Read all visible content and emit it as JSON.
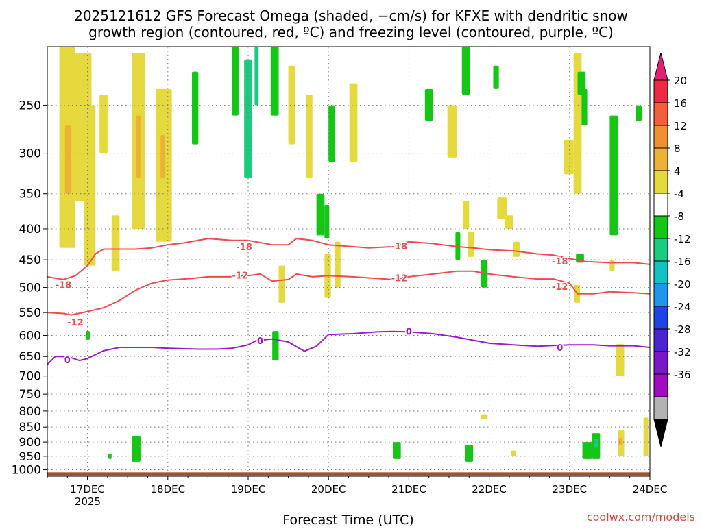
{
  "title_line1": "2025121612 GFS Forecast Omega (shaded, −cm/s) for KFXE with dendritic snow",
  "title_line2": "growth region (contoured, red, ºC) and freezing level (contoured, purple, ºC)",
  "xlabel": "Forecast Time (UTC)",
  "credit": "coolwx.com/models",
  "chart_data": {
    "type": "heatmap",
    "title": "2025121612 GFS Forecast Omega (shaded, −cm/s) for KFXE with dendritic snow growth region (contoured, red, ºC) and freezing level (contoured, purple, ºC)",
    "xlabel": "Forecast Time (UTC)",
    "ylabel": "",
    "x_tick_labels": [
      "17DEC",
      "18DEC",
      "19DEC",
      "20DEC",
      "21DEC",
      "22DEC",
      "23DEC",
      "24DEC"
    ],
    "x_tick_values": [
      17,
      18,
      19,
      20,
      21,
      22,
      23,
      24
    ],
    "x_year_label": "2025",
    "xlim": [
      16.5,
      24.0
    ],
    "y_tick_labels": [
      "250",
      "300",
      "350",
      "400",
      "450",
      "500",
      "550",
      "600",
      "650",
      "700",
      "750",
      "800",
      "850",
      "900",
      "950",
      "1000"
    ],
    "y_tick_values": [
      250,
      300,
      350,
      400,
      450,
      500,
      550,
      600,
      650,
      700,
      750,
      800,
      850,
      900,
      950,
      1000
    ],
    "ylim": [
      200,
      1025
    ],
    "y_scale": "log",
    "grid": true,
    "colorbar": {
      "labels": [
        "20",
        "16",
        "12",
        "8",
        "4",
        "-4",
        "-8",
        "-12",
        "-16",
        "-20",
        "-24",
        "-28",
        "-32",
        "-36"
      ],
      "colors": [
        "#ee2a43",
        "#f0603a",
        "#f09030",
        "#ecb238",
        "#e6d93d",
        "#ffffff",
        "#15c715",
        "#1acc80",
        "#12c2c2",
        "#1e96ea",
        "#1f44e6",
        "#4a23d2",
        "#7a18c8",
        "#a00cc0",
        "#b3b3b3"
      ],
      "top_arrow_color": "#e61e78",
      "bottom_arrow_color": "#000000"
    },
    "series": [
      {
        "name": "-18",
        "color": "#f24a4a",
        "x": [
          16.5,
          16.7,
          16.85,
          17.0,
          17.1,
          17.2,
          17.4,
          17.6,
          17.8,
          18.0,
          18.2,
          18.5,
          18.8,
          19.0,
          19.3,
          19.5,
          19.6,
          19.8,
          20.0,
          20.3,
          20.5,
          20.8,
          21.0,
          21.3,
          21.6,
          21.8,
          22.0,
          22.3,
          22.6,
          22.8,
          23.0,
          23.2,
          23.5,
          23.8,
          24.0
        ],
        "y": [
          480,
          485,
          478,
          460,
          440,
          432,
          432,
          432,
          430,
          425,
          422,
          415,
          418,
          418,
          425,
          425,
          415,
          418,
          425,
          428,
          430,
          428,
          420,
          423,
          428,
          430,
          433,
          435,
          440,
          442,
          448,
          453,
          455,
          455,
          458
        ]
      },
      {
        "name": "-12",
        "color": "#f24a4a",
        "x": [
          16.5,
          16.7,
          16.8,
          17.0,
          17.2,
          17.4,
          17.6,
          17.8,
          18.0,
          18.3,
          18.5,
          18.8,
          19.0,
          19.15,
          19.3,
          19.5,
          19.6,
          19.8,
          20.0,
          20.3,
          20.5,
          20.8,
          21.0,
          21.3,
          21.6,
          21.8,
          22.0,
          22.3,
          22.6,
          22.8,
          23.0,
          23.1,
          23.3,
          23.5,
          23.8,
          24.0
        ],
        "y": [
          550,
          552,
          555,
          548,
          540,
          525,
          505,
          492,
          486,
          483,
          480,
          480,
          478,
          475,
          488,
          485,
          475,
          480,
          478,
          480,
          482,
          485,
          480,
          475,
          470,
          470,
          475,
          480,
          484,
          484,
          492,
          512,
          512,
          508,
          510,
          512
        ]
      },
      {
        "name": "0",
        "color": "#9d19cc",
        "x": [
          16.5,
          16.6,
          16.75,
          16.9,
          17.0,
          17.2,
          17.4,
          17.6,
          17.8,
          18.0,
          18.2,
          18.4,
          18.6,
          18.8,
          19.0,
          19.1,
          19.3,
          19.5,
          19.7,
          19.85,
          20.0,
          20.3,
          20.6,
          20.8,
          21.0,
          21.3,
          21.6,
          22.0,
          22.3,
          22.6,
          23.0,
          23.3,
          23.5,
          23.8,
          24.0
        ],
        "y": [
          670,
          650,
          650,
          660,
          655,
          636,
          628,
          628,
          628,
          630,
          631,
          632,
          632,
          630,
          622,
          612,
          608,
          615,
          637,
          625,
          598,
          596,
          592,
          591,
          592,
          596,
          604,
          618,
          622,
          625,
          622,
          622,
          624,
          624,
          628
        ]
      }
    ],
    "contour_labels": [
      {
        "text": "-18",
        "x": 18.95,
        "y": 428,
        "color": "#f24a4a"
      },
      {
        "text": "-18",
        "x": 20.88,
        "y": 427,
        "color": "#f24a4a"
      },
      {
        "text": "-18",
        "x": 22.88,
        "y": 452,
        "color": "#f24a4a"
      },
      {
        "text": "-18",
        "x": 16.7,
        "y": 495,
        "color": "#f24a4a"
      },
      {
        "text": "-12",
        "x": 18.9,
        "y": 477,
        "color": "#f24a4a"
      },
      {
        "text": "-12",
        "x": 20.88,
        "y": 482,
        "color": "#f24a4a"
      },
      {
        "text": "-12",
        "x": 22.88,
        "y": 498,
        "color": "#f24a4a"
      },
      {
        "text": "-12",
        "x": 16.85,
        "y": 570,
        "color": "#f24a4a"
      },
      {
        "text": "0",
        "x": 19.15,
        "y": 612,
        "color": "#9d19cc"
      },
      {
        "text": "0",
        "x": 21.0,
        "y": 591,
        "color": "#9d19cc"
      },
      {
        "text": "0",
        "x": 22.88,
        "y": 628,
        "color": "#9d19cc"
      },
      {
        "text": "0",
        "x": 16.75,
        "y": 658,
        "color": "#9d19cc"
      }
    ],
    "omega_regions": [
      {
        "value": 6,
        "x": [
          16.65,
          16.85
        ],
        "y": [
          200,
          430
        ]
      },
      {
        "value": 10,
        "x": [
          16.72,
          16.8
        ],
        "y": [
          270,
          350
        ]
      },
      {
        "value": 6,
        "x": [
          16.85,
          17.05
        ],
        "y": [
          205,
          360
        ]
      },
      {
        "value": 6,
        "x": [
          16.96,
          17.1
        ],
        "y": [
          250,
          460
        ]
      },
      {
        "value": 6,
        "x": [
          17.15,
          17.25
        ],
        "y": [
          240,
          300
        ]
      },
      {
        "value": 6,
        "x": [
          17.3,
          17.4
        ],
        "y": [
          380,
          470
        ]
      },
      {
        "value": 6,
        "x": [
          17.55,
          17.72
        ],
        "y": [
          205,
          400
        ]
      },
      {
        "value": 10,
        "x": [
          17.6,
          17.66
        ],
        "y": [
          260,
          330
        ]
      },
      {
        "value": 6,
        "x": [
          17.85,
          18.05
        ],
        "y": [
          235,
          420
        ]
      },
      {
        "value": 10,
        "x": [
          17.91,
          17.96
        ],
        "y": [
          280,
          330
        ]
      },
      {
        "value": 6,
        "x": [
          19.38,
          19.46
        ],
        "y": [
          460,
          530
        ]
      },
      {
        "value": 6,
        "x": [
          19.5,
          19.58
        ],
        "y": [
          215,
          290
        ]
      },
      {
        "value": 6,
        "x": [
          19.72,
          19.8
        ],
        "y": [
          240,
          330
        ]
      },
      {
        "value": 6,
        "x": [
          19.95,
          20.03
        ],
        "y": [
          440,
          520
        ]
      },
      {
        "value": 6,
        "x": [
          20.08,
          20.15
        ],
        "y": [
          420,
          500
        ]
      },
      {
        "value": 6,
        "x": [
          20.26,
          20.36
        ],
        "y": [
          230,
          310
        ]
      },
      {
        "value": 6,
        "x": [
          21.48,
          21.6
        ],
        "y": [
          250,
          305
        ]
      },
      {
        "value": 6,
        "x": [
          21.67,
          21.75
        ],
        "y": [
          360,
          400
        ]
      },
      {
        "value": 6,
        "x": [
          21.73,
          21.81
        ],
        "y": [
          405,
          445
        ]
      },
      {
        "value": 6,
        "x": [
          22.1,
          22.22
        ],
        "y": [
          355,
          385
        ]
      },
      {
        "value": 6,
        "x": [
          22.2,
          22.3
        ],
        "y": [
          380,
          400
        ]
      },
      {
        "value": 6,
        "x": [
          22.3,
          22.38
        ],
        "y": [
          420,
          445
        ]
      },
      {
        "value": 6,
        "x": [
          22.93,
          23.05
        ],
        "y": [
          285,
          325
        ]
      },
      {
        "value": 6,
        "x": [
          23.05,
          23.15
        ],
        "y": [
          205,
          350
        ]
      },
      {
        "value": 6,
        "x": [
          23.06,
          23.13
        ],
        "y": [
          495,
          530
        ]
      },
      {
        "value": 6,
        "x": [
          23.5,
          23.56
        ],
        "y": [
          450,
          470
        ]
      },
      {
        "value": 6,
        "x": [
          23.58,
          23.68
        ],
        "y": [
          620,
          700
        ]
      },
      {
        "value": 6,
        "x": [
          23.6,
          23.68
        ],
        "y": [
          860,
          950
        ]
      },
      {
        "value": 10,
        "x": [
          23.61,
          23.66
        ],
        "y": [
          885,
          910
        ]
      },
      {
        "value": 6,
        "x": [
          23.92,
          23.98
        ],
        "y": [
          820,
          950
        ]
      },
      {
        "value": 6,
        "x": [
          21.9,
          21.98
        ],
        "y": [
          810,
          825
        ]
      },
      {
        "value": 6,
        "x": [
          22.27,
          22.33
        ],
        "y": [
          930,
          950
        ]
      },
      {
        "value": -6,
        "x": [
          19.28,
          19.38
        ],
        "y": [
          200,
          260
        ]
      },
      {
        "value": -6,
        "x": [
          18.8,
          18.88
        ],
        "y": [
          200,
          260
        ]
      },
      {
        "value": -6,
        "x": [
          18.3,
          18.38
        ],
        "y": [
          220,
          290
        ]
      },
      {
        "value": -6,
        "x": [
          19.85,
          19.95
        ],
        "y": [
          350,
          410
        ]
      },
      {
        "value": -6,
        "x": [
          19.95,
          20.01
        ],
        "y": [
          365,
          415
        ]
      },
      {
        "value": -6,
        "x": [
          20.0,
          20.08
        ],
        "y": [
          250,
          310
        ]
      },
      {
        "value": -6,
        "x": [
          21.2,
          21.3
        ],
        "y": [
          235,
          265
        ]
      },
      {
        "value": -6,
        "x": [
          21.66,
          21.76
        ],
        "y": [
          200,
          240
        ]
      },
      {
        "value": -6,
        "x": [
          21.58,
          21.64
        ],
        "y": [
          405,
          450
        ]
      },
      {
        "value": -6,
        "x": [
          21.9,
          21.98
        ],
        "y": [
          450,
          500
        ]
      },
      {
        "value": -6,
        "x": [
          22.05,
          22.12
        ],
        "y": [
          215,
          235
        ]
      },
      {
        "value": -6,
        "x": [
          23.15,
          23.22
        ],
        "y": [
          235,
          270
        ]
      },
      {
        "value": -6,
        "x": [
          23.1,
          23.2
        ],
        "y": [
          220,
          240
        ]
      },
      {
        "value": -6,
        "x": [
          23.08,
          23.18
        ],
        "y": [
          440,
          455
        ]
      },
      {
        "value": -6,
        "x": [
          23.5,
          23.6
        ],
        "y": [
          260,
          410
        ]
      },
      {
        "value": -6,
        "x": [
          23.82,
          23.9
        ],
        "y": [
          250,
          265
        ]
      },
      {
        "value": -6,
        "x": [
          17.55,
          17.66
        ],
        "y": [
          880,
          970
        ]
      },
      {
        "value": -6,
        "x": [
          19.3,
          19.38
        ],
        "y": [
          590,
          660
        ]
      },
      {
        "value": -6,
        "x": [
          20.8,
          20.9
        ],
        "y": [
          900,
          960
        ]
      },
      {
        "value": -6,
        "x": [
          21.7,
          21.8
        ],
        "y": [
          910,
          970
        ]
      },
      {
        "value": -6,
        "x": [
          23.16,
          23.28
        ],
        "y": [
          900,
          960
        ]
      },
      {
        "value": -6,
        "x": [
          23.28,
          23.38
        ],
        "y": [
          870,
          960
        ]
      },
      {
        "value": -10,
        "x": [
          18.95,
          19.05
        ],
        "y": [
          210,
          330
        ]
      },
      {
        "value": -10,
        "x": [
          19.08,
          19.13
        ],
        "y": [
          200,
          250
        ]
      },
      {
        "value": -10,
        "x": [
          23.3,
          23.36
        ],
        "y": [
          890,
          920
        ]
      },
      {
        "value": -6,
        "x": [
          16.98,
          17.03
        ],
        "y": [
          590,
          610
        ]
      },
      {
        "value": -6,
        "x": [
          17.26,
          17.3
        ],
        "y": [
          940,
          960
        ]
      }
    ],
    "terrain": {
      "color": "#a0522d",
      "pressure_top": 1010
    }
  }
}
